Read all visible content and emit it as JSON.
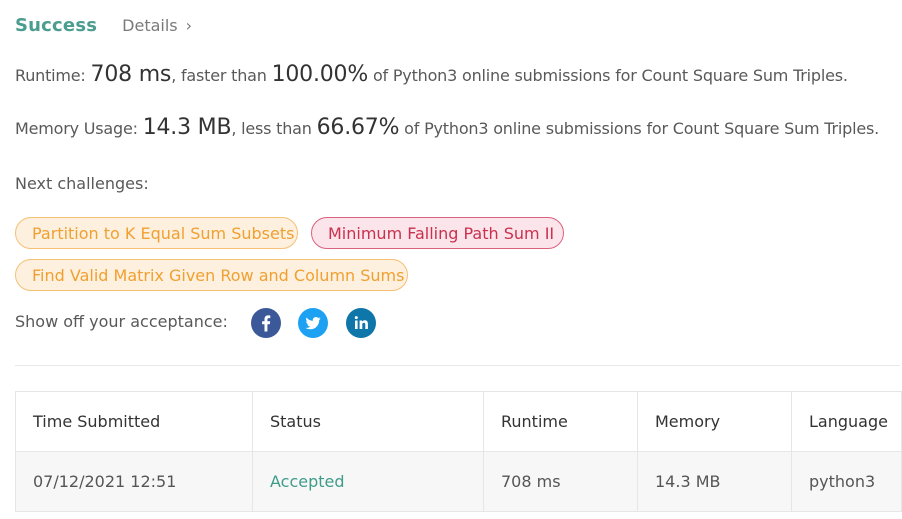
{
  "header": {
    "status": "Success",
    "details_label": "Details",
    "chevron": "›"
  },
  "runtime": {
    "label": "Runtime: ",
    "value": "708 ms",
    "mid": ", faster than ",
    "percent": "100.00%",
    "suffix": " of Python3 online submissions for Count Square Sum Triples."
  },
  "memory": {
    "label": "Memory Usage: ",
    "value": "14.3 MB",
    "mid": ", less than ",
    "percent": "66.67%",
    "suffix": " of Python3 online submissions for Count Square Sum Triples."
  },
  "next": {
    "label": "Next challenges:",
    "challenges": [
      {
        "title": "Partition to K Equal Sum Subsets",
        "difficulty_color": "#f0a030"
      },
      {
        "title": "Minimum Falling Path Sum II",
        "difficulty_color": "#c8314f"
      },
      {
        "title": "Find Valid Matrix Given Row and Column Sums",
        "difficulty_color": "#f0a030"
      }
    ]
  },
  "share": {
    "label": "Show off your acceptance:",
    "icons": [
      "facebook-icon",
      "twitter-icon",
      "linkedin-icon"
    ]
  },
  "table": {
    "headers": [
      "Time Submitted",
      "Status",
      "Runtime",
      "Memory",
      "Language"
    ],
    "rows": [
      [
        "07/12/2021 12:51",
        "Accepted",
        "708 ms",
        "14.3 MB",
        "python3"
      ]
    ]
  },
  "colors": {
    "success": "#4a9d8f",
    "accepted": "#3f9c8a",
    "medium": "#f0a030",
    "hard": "#c8314f",
    "facebook": "#3b5998",
    "twitter": "#1da1f2",
    "linkedin": "#0e76a8"
  }
}
